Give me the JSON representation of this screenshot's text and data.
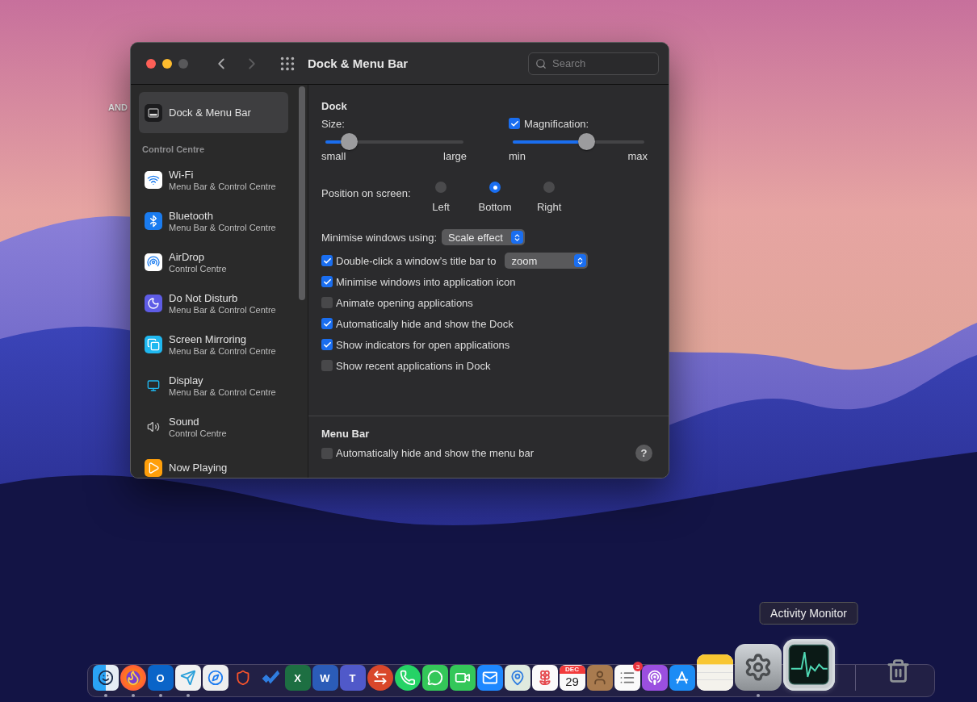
{
  "desktop": {
    "icon_label": "AND"
  },
  "window": {
    "title": "Dock & Menu Bar",
    "traffic_lights": [
      {
        "kind": "close",
        "disabled": false
      },
      {
        "kind": "minimize",
        "disabled": false
      },
      {
        "kind": "zoom",
        "disabled": true
      }
    ],
    "nav": [
      {
        "kind": "back",
        "disabled": false
      },
      {
        "kind": "forward",
        "disabled": true
      }
    ],
    "search": {
      "placeholder": "Search"
    }
  },
  "sidebar": {
    "items": [
      {
        "kind": "dock",
        "title": "Dock & Menu Bar",
        "selected": true
      }
    ],
    "section": {
      "heading": "Control Centre",
      "items": [
        {
          "kind": "wifi",
          "title": "Wi-Fi",
          "subtitle": "Menu Bar & Control Centre",
          "selected": false
        },
        {
          "kind": "bluetooth",
          "title": "Bluetooth",
          "subtitle": "Menu Bar & Control Centre",
          "selected": false
        },
        {
          "kind": "airdrop",
          "title": "AirDrop",
          "subtitle": "Control Centre",
          "selected": false
        },
        {
          "kind": "dnd",
          "title": "Do Not Disturb",
          "subtitle": "Menu Bar & Control Centre",
          "selected": false
        },
        {
          "kind": "mirroring",
          "title": "Screen Mirroring",
          "subtitle": "Menu Bar & Control Centre",
          "selected": false
        },
        {
          "kind": "display",
          "title": "Display",
          "subtitle": "Menu Bar & Control Centre",
          "selected": false
        },
        {
          "kind": "sound",
          "title": "Sound",
          "subtitle": "Control Centre",
          "selected": false
        },
        {
          "kind": "nowplaying",
          "title": "Now Playing",
          "selected": false
        }
      ]
    }
  },
  "dock_section": {
    "heading": "Dock",
    "size": {
      "label": "Size:",
      "level": 0.17,
      "min_label": "small",
      "max_label": "large"
    },
    "magnification": {
      "label": "Magnification:",
      "checked": true,
      "level": 0.56,
      "min_label": "min",
      "max_label": "max"
    },
    "position": {
      "label": "Position on screen:",
      "options": [
        {
          "label": "Left",
          "selected": false
        },
        {
          "label": "Bottom",
          "selected": true
        },
        {
          "label": "Right",
          "selected": false
        }
      ]
    },
    "minimise": {
      "label": "Minimise windows using:",
      "value": "Scale effect"
    },
    "options": [
      {
        "kind": "check_select",
        "label": "Double-click a window’s title bar to",
        "checked": true,
        "value": "zoom"
      },
      {
        "kind": "check",
        "label": "Minimise windows into application icon",
        "checked": true
      },
      {
        "kind": "check",
        "label": "Animate opening applications",
        "checked": false
      },
      {
        "kind": "check",
        "label": "Automatically hide and show the Dock",
        "checked": true
      },
      {
        "kind": "check",
        "label": "Show indicators for open applications",
        "checked": true
      },
      {
        "kind": "check",
        "label": "Show recent applications in Dock",
        "checked": false
      }
    ]
  },
  "menu_bar_section": {
    "heading": "Menu Bar",
    "options": [
      {
        "kind": "check",
        "label": "Automatically hide and show the menu bar",
        "checked": false
      }
    ],
    "help": "?"
  },
  "dock": {
    "tooltip": "Activity Monitor",
    "apps": [
      {
        "kind": "finder",
        "running": true,
        "hovered": false
      },
      {
        "kind": "firefox",
        "running": true,
        "hovered": false
      },
      {
        "kind": "outlook",
        "letter": "O",
        "running": true,
        "hovered": false
      },
      {
        "kind": "telegram",
        "running": true,
        "hovered": false
      },
      {
        "kind": "safari",
        "running": false,
        "hovered": false
      },
      {
        "kind": "brave",
        "running": false,
        "hovered": false
      },
      {
        "kind": "todo",
        "running": false,
        "hovered": false
      },
      {
        "kind": "excel",
        "letter": "X",
        "running": false,
        "hovered": false
      },
      {
        "kind": "word",
        "letter": "W",
        "running": false,
        "hovered": false
      },
      {
        "kind": "teams",
        "letter": "T",
        "running": false,
        "hovered": false
      },
      {
        "kind": "remote",
        "running": false,
        "hovered": false
      },
      {
        "kind": "whatsapp",
        "running": false,
        "hovered": false
      },
      {
        "kind": "messages",
        "running": false,
        "hovered": false
      },
      {
        "kind": "facetime",
        "running": false,
        "hovered": false
      },
      {
        "kind": "mail",
        "running": false,
        "hovered": false
      },
      {
        "kind": "maps",
        "running": false,
        "hovered": false
      },
      {
        "kind": "photos",
        "running": false,
        "hovered": false
      },
      {
        "kind": "calendar",
        "month": "DEC",
        "day": "29",
        "running": false,
        "hovered": false
      },
      {
        "kind": "contacts",
        "running": false,
        "hovered": false
      },
      {
        "kind": "reminders",
        "badge": "3",
        "running": false,
        "hovered": false
      },
      {
        "kind": "podcasts",
        "running": false,
        "hovered": false
      },
      {
        "kind": "appstore",
        "running": false,
        "hovered": false
      },
      {
        "kind": "notes",
        "running": false,
        "hovered": false
      },
      {
        "kind": "settings",
        "running": true,
        "hovered": false
      },
      {
        "kind": "activity",
        "running": false,
        "hovered": true
      }
    ],
    "after_separator": [
      {
        "kind": "trash",
        "running": false,
        "hovered": false
      }
    ]
  }
}
